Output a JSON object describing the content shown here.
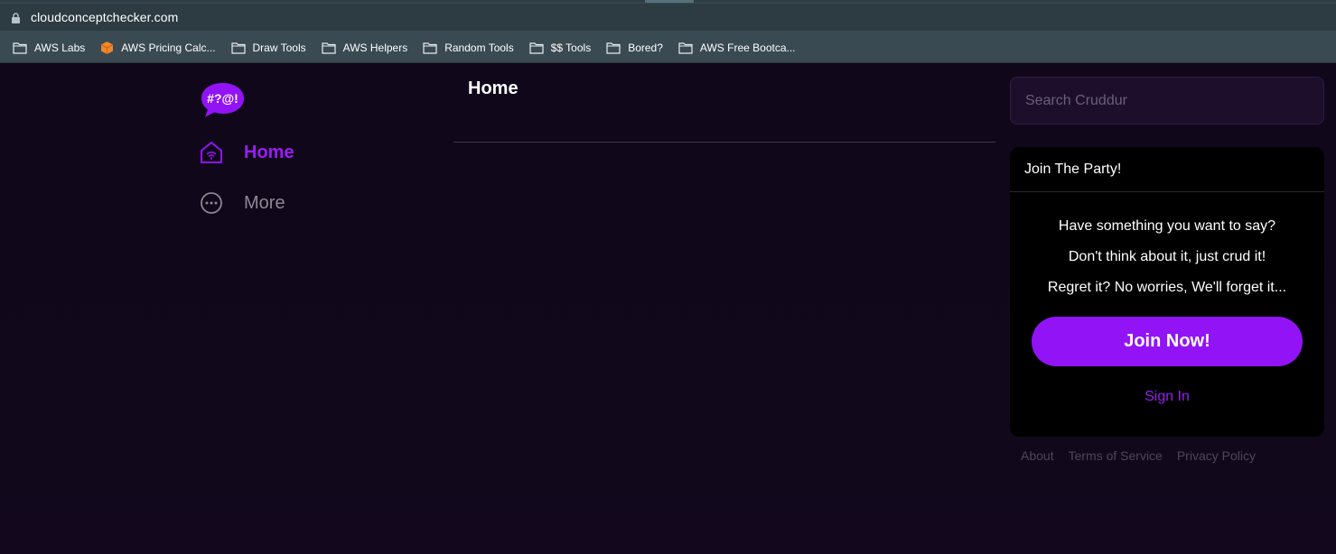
{
  "browser": {
    "url": "cloudconceptchecker.com",
    "bookmarks": [
      {
        "label": "AWS Labs",
        "icon": "folder-icon"
      },
      {
        "label": "AWS Pricing Calc...",
        "icon": "aws-pricing-icon"
      },
      {
        "label": "Draw Tools",
        "icon": "folder-icon"
      },
      {
        "label": "AWS Helpers",
        "icon": "folder-icon"
      },
      {
        "label": "Random Tools",
        "icon": "folder-icon"
      },
      {
        "label": "$$ Tools",
        "icon": "folder-icon"
      },
      {
        "label": "Bored?",
        "icon": "folder-icon"
      },
      {
        "label": "AWS Free Bootca...",
        "icon": "folder-icon"
      }
    ]
  },
  "sidebar": {
    "logo_text": "#?@!",
    "items": [
      {
        "label": "Home",
        "icon": "home-icon",
        "active": true
      },
      {
        "label": "More",
        "icon": "more-icon",
        "active": false
      }
    ]
  },
  "main": {
    "title": "Home"
  },
  "search": {
    "placeholder": "Search Cruddur"
  },
  "join_card": {
    "title": "Join The Party!",
    "lines": [
      "Have something you want to say?",
      "Don't think about it, just crud it!",
      "Regret it? No worries, We'll forget it..."
    ],
    "join_button": "Join Now!",
    "sign_in": "Sign In"
  },
  "footer": {
    "links": [
      "About",
      "Terms of Service",
      "Privacy Policy"
    ]
  },
  "colors": {
    "accent": "#9213f5",
    "background": "#0f0816",
    "card": "#000000",
    "muted_text": "#8c8792"
  }
}
